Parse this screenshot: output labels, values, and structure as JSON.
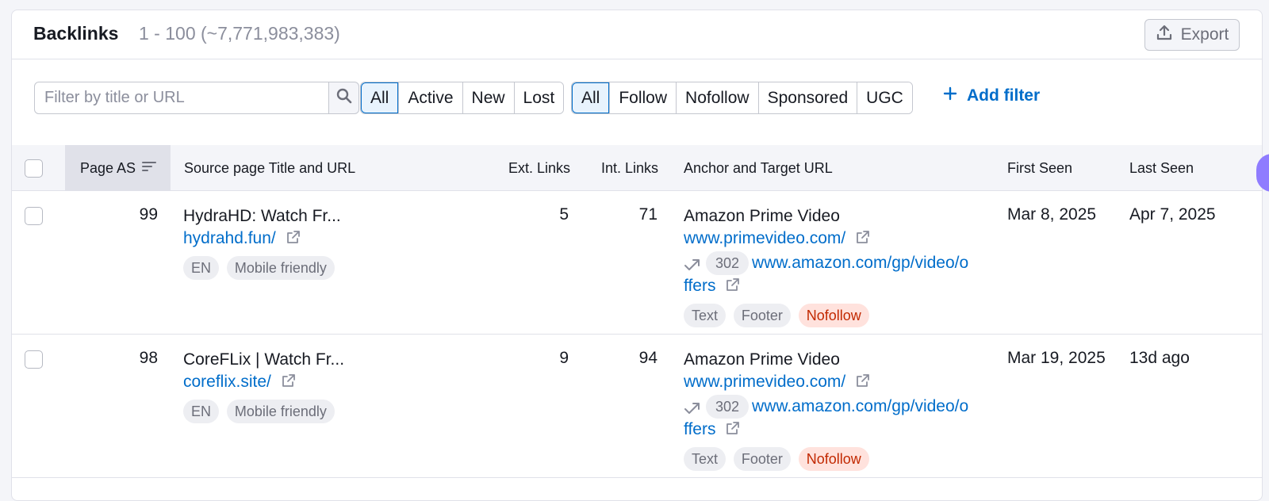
{
  "header": {
    "title": "Backlinks",
    "count": "1 - 100 (~7,771,983,383)",
    "export_label": "Export"
  },
  "filters": {
    "search_placeholder": "Filter by title or URL",
    "status_options": [
      "All",
      "Active",
      "New",
      "Lost"
    ],
    "status_selected": "All",
    "type_options": [
      "All",
      "Follow",
      "Nofollow",
      "Sponsored",
      "UGC"
    ],
    "type_selected": "All",
    "add_filter_label": "Add filter"
  },
  "columns": {
    "page_as": "Page AS",
    "source": "Source page Title and URL",
    "ext_links": "Ext. Links",
    "int_links": "Int. Links",
    "anchor": "Anchor and Target URL",
    "first_seen": "First Seen",
    "last_seen": "Last Seen"
  },
  "rows": [
    {
      "page_as": "99",
      "title": "HydraHD: Watch Fr...",
      "url": "hydrahd.fun/",
      "tags": [
        "EN",
        "Mobile friendly"
      ],
      "ext_links": "5",
      "int_links": "71",
      "anchor": "Amazon Prime Video",
      "target_url": "www.primevideo.com/",
      "redirect_code": "302",
      "redirect_url_1": "www.amazon.com/gp/video/o",
      "redirect_url_2": "ffers",
      "link_tags": [
        "Text",
        "Footer",
        "Nofollow"
      ],
      "first_seen": "Mar 8, 2025",
      "last_seen": "Apr 7, 2025"
    },
    {
      "page_as": "98",
      "title": "CoreFLix | Watch Fr...",
      "url": "coreflix.site/",
      "tags": [
        "EN",
        "Mobile friendly"
      ],
      "ext_links": "9",
      "int_links": "94",
      "anchor": "Amazon Prime Video",
      "target_url": "www.primevideo.com/",
      "redirect_code": "302",
      "redirect_url_1": "www.amazon.com/gp/video/o",
      "redirect_url_2": "ffers",
      "link_tags": [
        "Text",
        "Footer",
        "Nofollow"
      ],
      "first_seen": "Mar 19, 2025",
      "last_seen": "13d ago"
    }
  ],
  "colors": {
    "accent": "#006dca",
    "nofollow_bg": "#ffe2dd",
    "nofollow_text": "#c22800",
    "scroll_handle": "#8f7cff"
  }
}
